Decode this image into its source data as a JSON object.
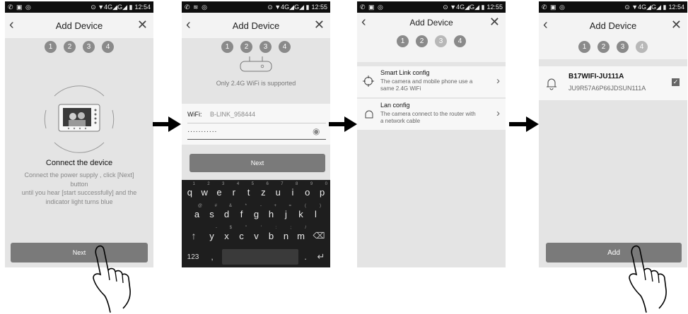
{
  "status_bars": [
    {
      "left_icons": "✆ ▣ ◎",
      "signal": "⊙ ▼4G◢G◢ ▮",
      "time": "12:54"
    },
    {
      "left_icons": "✆ ≋ ◎",
      "signal": "⊙ ▼4G◢G◢ ▮",
      "time": "12:55"
    },
    {
      "left_icons": "✆ ▣ ◎",
      "signal": "⊙ ▼4G◢G◢ ▮",
      "time": "12:55"
    },
    {
      "left_icons": "✆ ▣ ◎",
      "signal": "⊙ ▼4G◢G◢ ▮",
      "time": "12:54"
    }
  ],
  "title": "Add Device",
  "steps": [
    "1",
    "2",
    "3",
    "4"
  ],
  "screen1": {
    "heading": "Connect the device",
    "body": [
      "Connect the power supply , click [Next]",
      "button",
      "until you hear [start successfully] and the",
      "indicator light turns blue"
    ],
    "next_label": "Next"
  },
  "screen2": {
    "notice": "Only 2.4G WiFi is supported",
    "wifi_label": "WiFi:",
    "wifi_value": "B-LINK_958444",
    "password_mask": "···········",
    "next_label": "Next",
    "keyboard": {
      "row1": [
        [
          "q",
          "1"
        ],
        [
          "w",
          "2"
        ],
        [
          "e",
          "3"
        ],
        [
          "r",
          "4"
        ],
        [
          "t",
          "5"
        ],
        [
          "z",
          "6"
        ],
        [
          "u",
          "7"
        ],
        [
          "i",
          "8"
        ],
        [
          "o",
          "9"
        ],
        [
          "p",
          "0"
        ]
      ],
      "row2": [
        [
          "a",
          "@"
        ],
        [
          "s",
          "#"
        ],
        [
          "d",
          "&"
        ],
        [
          "f",
          "*"
        ],
        [
          "g",
          "-"
        ],
        [
          "h",
          "+"
        ],
        [
          "j",
          "="
        ],
        [
          "k",
          "("
        ],
        [
          "l",
          ")"
        ]
      ],
      "row3": [
        [
          "y",
          "-"
        ],
        [
          "x",
          "$"
        ],
        [
          "c",
          "\""
        ],
        [
          "v",
          "'"
        ],
        [
          "b",
          ":"
        ],
        [
          "n",
          ";"
        ],
        [
          "m",
          "/"
        ]
      ],
      "numbers_key": "123",
      "comma_key": ",",
      "period_key": "."
    }
  },
  "screen3": {
    "options": [
      {
        "title": "Smart Link config",
        "desc1": "The camera and mobile phone use a",
        "desc2": "same 2.4G WiFi"
      },
      {
        "title": "Lan config",
        "desc1": "The camera connect to the router with",
        "desc2": "a network  cable"
      }
    ]
  },
  "screen4": {
    "device_name": "B17WIFI-JU111A",
    "device_id": "JU9R57A6P66JDSUN111A",
    "add_label": "Add"
  }
}
